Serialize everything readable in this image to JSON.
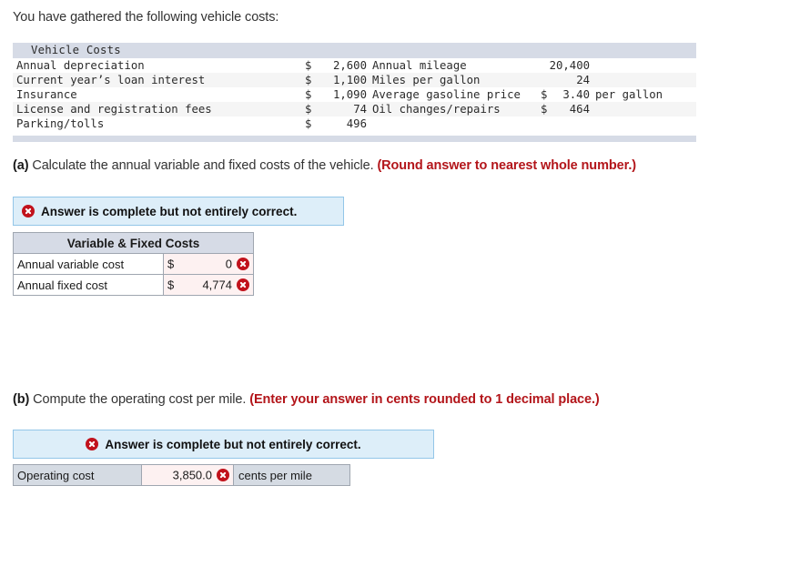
{
  "intro": "You have gathered the following vehicle costs:",
  "costs_table": {
    "title": "Vehicle Costs",
    "rows": [
      {
        "label": "Annual depreciation",
        "currency": "$",
        "amount": "2,600",
        "label2": "Annual mileage",
        "currency2": "",
        "amount2": "20,400",
        "unit2": ""
      },
      {
        "label": "Current year’s loan interest",
        "currency": "$",
        "amount": "1,100",
        "label2": "Miles per gallon",
        "currency2": "",
        "amount2": "24",
        "unit2": ""
      },
      {
        "label": "Insurance",
        "currency": "$",
        "amount": "1,090",
        "label2": "Average gasoline price",
        "currency2": "$",
        "amount2": "3.40",
        "unit2": "per gallon"
      },
      {
        "label": "License and registration fees",
        "currency": "$",
        "amount": "74",
        "label2": "Oil changes/repairs",
        "currency2": "$",
        "amount2": "464",
        "unit2": ""
      },
      {
        "label": "Parking/tolls",
        "currency": "$",
        "amount": "496",
        "label2": "",
        "currency2": "",
        "amount2": "",
        "unit2": ""
      }
    ]
  },
  "part_a": {
    "marker": "(a)",
    "question": " Calculate the annual variable and fixed costs of the vehicle. ",
    "note": "(Round answer to nearest whole number.)",
    "banner_text": "Answer is complete but not entirely correct.",
    "banner_icon": "error-x-icon",
    "table": {
      "header": "Variable & Fixed Costs",
      "rows": [
        {
          "label": "Annual variable cost",
          "currency": "$",
          "value": "0",
          "status": "incorrect"
        },
        {
          "label": "Annual fixed cost",
          "currency": "$",
          "value": "4,774",
          "status": "incorrect"
        }
      ]
    }
  },
  "part_b": {
    "marker": "(b)",
    "question": " Compute the operating cost per mile. ",
    "note": "(Enter your answer in cents rounded to 1 decimal place.)",
    "banner_text": "Answer is complete but not entirely correct.",
    "banner_icon": "error-x-icon",
    "table": {
      "row": {
        "label": "Operating cost",
        "value": "3,850.0",
        "unit": "cents per mile",
        "status": "incorrect"
      }
    }
  },
  "colors": {
    "header_band": "#d6dbe6",
    "row_alt": "#f5f5f5",
    "banner_bg": "#ddeef9",
    "banner_border": "#93c6e8",
    "error_red": "#c1121c",
    "note_red": "#b3151a",
    "answer_cell": "#fdf1f1"
  }
}
